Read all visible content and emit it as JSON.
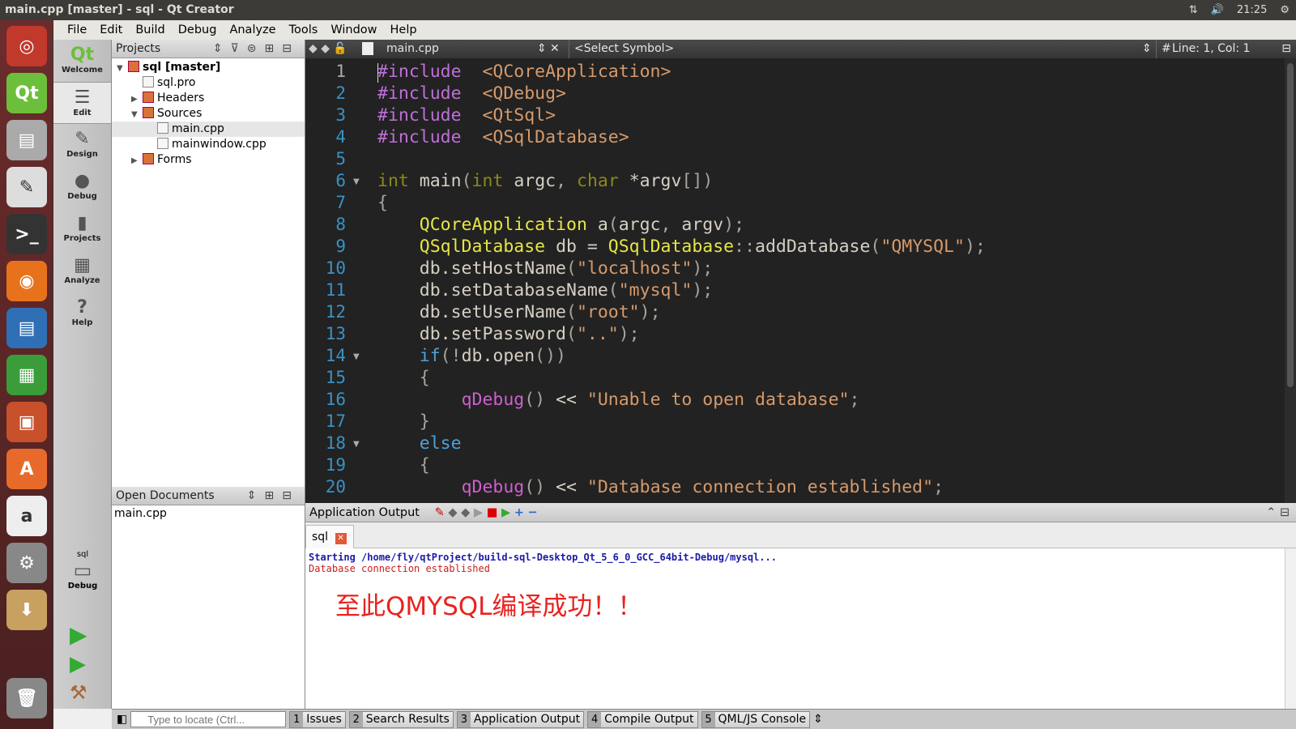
{
  "window": {
    "title": "main.cpp [master] - sql - Qt Creator",
    "time": "21:25"
  },
  "menu": [
    "File",
    "Edit",
    "Build",
    "Debug",
    "Analyze",
    "Tools",
    "Window",
    "Help"
  ],
  "modes": [
    {
      "label": "Welcome",
      "icon": "Qt"
    },
    {
      "label": "Edit",
      "icon": "☰"
    },
    {
      "label": "Design",
      "icon": "✎"
    },
    {
      "label": "Debug",
      "icon": "●"
    },
    {
      "label": "Projects",
      "icon": "▮"
    },
    {
      "label": "Analyze",
      "icon": "▦"
    },
    {
      "label": "Help",
      "icon": "?"
    }
  ],
  "kit": {
    "project": "sql",
    "mode": "Debug"
  },
  "projects": {
    "header": "Projects",
    "tree": [
      {
        "label": "sql [master]",
        "depth": 0,
        "arrow": "▼",
        "bold": true
      },
      {
        "label": "sql.pro",
        "depth": 1,
        "arrow": ""
      },
      {
        "label": "Headers",
        "depth": 1,
        "arrow": "▶"
      },
      {
        "label": "Sources",
        "depth": 1,
        "arrow": "▼"
      },
      {
        "label": "main.cpp",
        "depth": 2,
        "arrow": "",
        "selected": true
      },
      {
        "label": "mainwindow.cpp",
        "depth": 2,
        "arrow": ""
      },
      {
        "label": "Forms",
        "depth": 1,
        "arrow": "▶"
      }
    ]
  },
  "open_documents": {
    "header": "Open Documents",
    "items": [
      "main.cpp"
    ]
  },
  "editor": {
    "file": "main.cpp",
    "symbol": "<Select Symbol>",
    "position": "Line: 1, Col: 1",
    "lines": [
      [
        [
          "pp",
          "#include"
        ],
        [
          "",
          "  "
        ],
        [
          "inc",
          "<QCoreApplication>"
        ]
      ],
      [
        [
          "pp",
          "#include"
        ],
        [
          "",
          "  "
        ],
        [
          "inc",
          "<QDebug>"
        ]
      ],
      [
        [
          "pp",
          "#include"
        ],
        [
          "",
          "  "
        ],
        [
          "inc",
          "<QtSql>"
        ]
      ],
      [
        [
          "pp",
          "#include"
        ],
        [
          "",
          "  "
        ],
        [
          "inc",
          "<QSqlDatabase>"
        ]
      ],
      [],
      [
        [
          "kw",
          "int"
        ],
        [
          "",
          " main"
        ],
        [
          "p",
          "("
        ],
        [
          "kw",
          "int"
        ],
        [
          "",
          " argc"
        ],
        [
          "p",
          ", "
        ],
        [
          "kw",
          "char"
        ],
        [
          "",
          " *argv"
        ],
        [
          "p",
          "[])"
        ]
      ],
      [
        [
          "p",
          "{"
        ]
      ],
      [
        [
          "",
          "    "
        ],
        [
          "ty",
          "QCoreApplication"
        ],
        [
          "",
          " a"
        ],
        [
          "p",
          "("
        ],
        [
          "",
          "argc"
        ],
        [
          "p",
          ", "
        ],
        [
          "",
          "argv"
        ],
        [
          "p",
          ");"
        ]
      ],
      [
        [
          "",
          "    "
        ],
        [
          "ty",
          "QSqlDatabase"
        ],
        [
          "",
          " db = "
        ],
        [
          "ty",
          "QSqlDatabase"
        ],
        [
          "p",
          "::"
        ],
        [
          "",
          "addDatabase"
        ],
        [
          "p",
          "("
        ],
        [
          "str",
          "\"QMYSQL\""
        ],
        [
          "p",
          ");"
        ]
      ],
      [
        [
          "",
          "    db.setHostName"
        ],
        [
          "p",
          "("
        ],
        [
          "str",
          "\"localhost\""
        ],
        [
          "p",
          ");"
        ]
      ],
      [
        [
          "",
          "    db.setDatabaseName"
        ],
        [
          "p",
          "("
        ],
        [
          "str",
          "\"mysql\""
        ],
        [
          "p",
          ");"
        ]
      ],
      [
        [
          "",
          "    db.setUserName"
        ],
        [
          "p",
          "("
        ],
        [
          "str",
          "\"root\""
        ],
        [
          "p",
          ");"
        ]
      ],
      [
        [
          "",
          "    db.setPassword"
        ],
        [
          "p",
          "("
        ],
        [
          "str",
          "\"..\""
        ],
        [
          "p",
          ");"
        ]
      ],
      [
        [
          "",
          "    "
        ],
        [
          "kb",
          "if"
        ],
        [
          "p",
          "(!"
        ],
        [
          "",
          "db.open"
        ],
        [
          "p",
          "())"
        ]
      ],
      [
        [
          "",
          "    "
        ],
        [
          "p",
          "{"
        ]
      ],
      [
        [
          "",
          "        "
        ],
        [
          "fn",
          "qDebug"
        ],
        [
          "p",
          "()"
        ],
        [
          "",
          " << "
        ],
        [
          "str",
          "\"Unable to open database\""
        ],
        [
          "p",
          ";"
        ]
      ],
      [
        [
          "",
          "    "
        ],
        [
          "p",
          "}"
        ]
      ],
      [
        [
          "",
          "    "
        ],
        [
          "kb",
          "else"
        ]
      ],
      [
        [
          "",
          "    "
        ],
        [
          "p",
          "{"
        ]
      ],
      [
        [
          "",
          "        "
        ],
        [
          "fn",
          "qDebug"
        ],
        [
          "p",
          "()"
        ],
        [
          "",
          " << "
        ],
        [
          "str",
          "\"Database connection established\""
        ],
        [
          "p",
          ";"
        ]
      ]
    ],
    "fold_lines": [
      6,
      14,
      18
    ]
  },
  "output": {
    "header": "Application Output",
    "tab": "sql",
    "line1": "Starting /home/fly/qtProject/build-sql-Desktop_Qt_5_6_0_GCC_64bit-Debug/mysql...",
    "line2": "Database connection established",
    "note": "至此QMYSQL编译成功！！",
    "note_color": "#e8231f"
  },
  "statusbar": {
    "locate_placeholder": "Type to locate (Ctrl...",
    "panes": [
      {
        "n": "1",
        "label": "Issues"
      },
      {
        "n": "2",
        "label": "Search Results"
      },
      {
        "n": "3",
        "label": "Application Output"
      },
      {
        "n": "4",
        "label": "Compile Output"
      },
      {
        "n": "5",
        "label": "QML/JS Console"
      }
    ]
  },
  "launcher": [
    {
      "name": "ubuntu",
      "color": "#c0392b",
      "g": "◎"
    },
    {
      "name": "qt-creator",
      "color": "#6cbf3a",
      "g": "Qt"
    },
    {
      "name": "files",
      "color": "#aaa",
      "g": "▤"
    },
    {
      "name": "text-editor",
      "color": "#ddd",
      "g": "✎"
    },
    {
      "name": "terminal",
      "color": "#333",
      "g": ">_"
    },
    {
      "name": "firefox",
      "color": "#e8721c",
      "g": "◉"
    },
    {
      "name": "writer",
      "color": "#2f6fb5",
      "g": "▤"
    },
    {
      "name": "calc",
      "color": "#3a9d3a",
      "g": "▦"
    },
    {
      "name": "impress",
      "color": "#c8502a",
      "g": "▣"
    },
    {
      "name": "software-center",
      "color": "#e86a2a",
      "g": "A"
    },
    {
      "name": "amazon",
      "color": "#eee",
      "g": "a"
    },
    {
      "name": "settings",
      "color": "#888",
      "g": "⚙"
    },
    {
      "name": "archive",
      "color": "#c8a060",
      "g": "⬇"
    }
  ]
}
